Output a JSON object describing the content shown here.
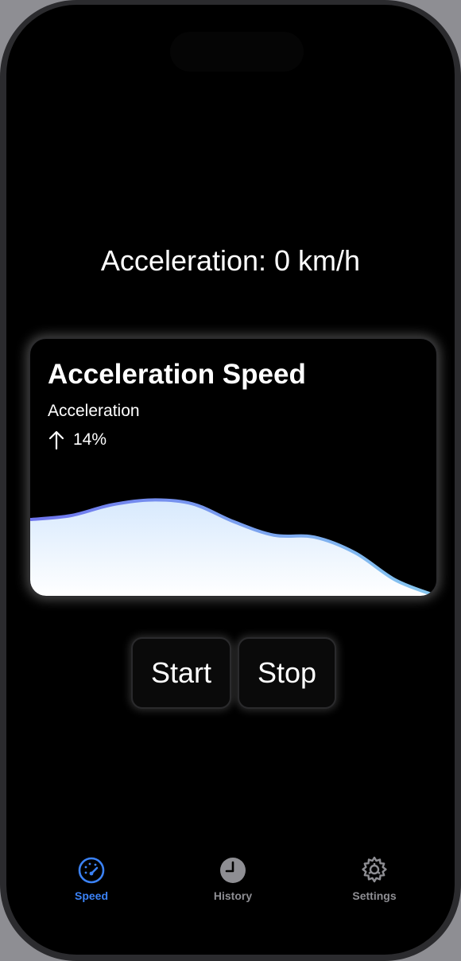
{
  "speed_screen": {
    "readout": "Acceleration: 0 km/h"
  },
  "card": {
    "title": "Acceleration Speed",
    "subtitle": "Acceleration",
    "trend_icon": "arrow-up-icon",
    "trend_value": "14%"
  },
  "chart_data": {
    "type": "area",
    "x": [
      0,
      1,
      2,
      3,
      4,
      5,
      6,
      7,
      8,
      9,
      10
    ],
    "values": [
      0.78,
      0.82,
      0.93,
      0.98,
      0.94,
      0.76,
      0.62,
      0.6,
      0.44,
      0.16,
      0.0
    ],
    "ylim": [
      0,
      1
    ],
    "grid": false,
    "colors": {
      "line_start": "#6d74ee",
      "line_end": "#86c8f0",
      "fill_top": "#d7e9fd",
      "fill_bottom": "#ffffff"
    }
  },
  "controls": {
    "start_label": "Start",
    "stop_label": "Stop"
  },
  "tabbar": {
    "tabs": [
      {
        "label": "Speed",
        "icon": "speedometer-icon",
        "active": true
      },
      {
        "label": "History",
        "icon": "clock-icon",
        "active": false
      },
      {
        "label": "Settings",
        "icon": "gear-icon",
        "active": false
      }
    ],
    "active_color": "#3b82f6",
    "inactive_color": "#8e8e93"
  }
}
